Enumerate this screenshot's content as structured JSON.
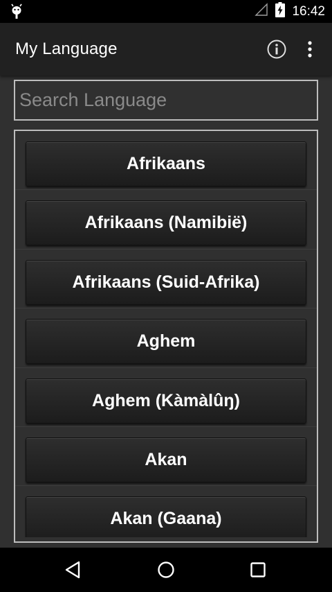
{
  "status_bar": {
    "time": "16:42",
    "icons": [
      "android-debug-icon",
      "signal-icon",
      "battery-charging-icon"
    ]
  },
  "app_bar": {
    "title": "My Language",
    "actions": [
      "info-icon",
      "overflow-menu-icon"
    ]
  },
  "search": {
    "placeholder": "Search Language",
    "value": ""
  },
  "languages": [
    "Afrikaans",
    "Afrikaans (Namibië)",
    "Afrikaans (Suid-Afrika)",
    "Aghem",
    "Aghem (Kàmàlûŋ)",
    "Akan",
    "Akan (Gaana)"
  ],
  "nav_bar": {
    "buttons": [
      "back-icon",
      "home-icon",
      "recents-icon"
    ]
  },
  "colors": {
    "background": "#303030",
    "app_bar": "#212121",
    "status_bar": "#000000",
    "border": "#bdbdbd"
  }
}
